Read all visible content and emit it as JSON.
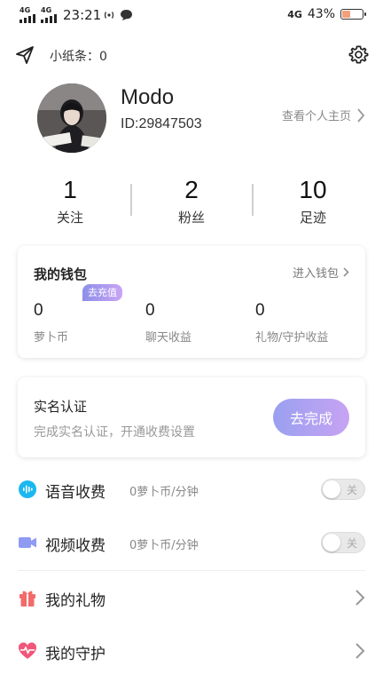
{
  "status_bar": {
    "net1": "4G",
    "net2": "4G",
    "time": "23:21",
    "net3": "4G",
    "battery": "43%",
    "battery_level": 0.43
  },
  "header": {
    "note_label": "小纸条：0"
  },
  "profile": {
    "name": "Modo",
    "id": "ID:29847503",
    "homepage_link": "查看个人主页"
  },
  "stats": [
    {
      "value": "1",
      "label": "关注"
    },
    {
      "value": "2",
      "label": "粉丝"
    },
    {
      "value": "10",
      "label": "足迹"
    }
  ],
  "wallet": {
    "title": "我的钱包",
    "enter_label": "进入钱包",
    "recharge_badge": "去充值",
    "items": [
      {
        "value": "0",
        "label": "萝卜币"
      },
      {
        "value": "0",
        "label": "聊天收益"
      },
      {
        "value": "0",
        "label": "礼物/守护收益"
      }
    ]
  },
  "real_name": {
    "title": "实名认证",
    "subtitle": "完成实名认证，开通收费设置",
    "button": "去完成"
  },
  "menu": {
    "voice": {
      "label": "语音收费",
      "price": "0萝卜币/分钟",
      "toggle": "关",
      "enabled": false
    },
    "video": {
      "label": "视频收费",
      "price": "0萝卜币/分钟",
      "toggle": "关",
      "enabled": false
    },
    "gifts": {
      "label": "我的礼物"
    },
    "guard": {
      "label": "我的守护"
    }
  },
  "colors": {
    "accent_gradient_start": "#9aa0f0",
    "accent_gradient_end": "#c7a3f3",
    "voice_icon": "#1bb8f0",
    "video_icon": "#8f9bf2",
    "gift_icon": "#f26b6b",
    "guard_icon": "#f0567a"
  }
}
